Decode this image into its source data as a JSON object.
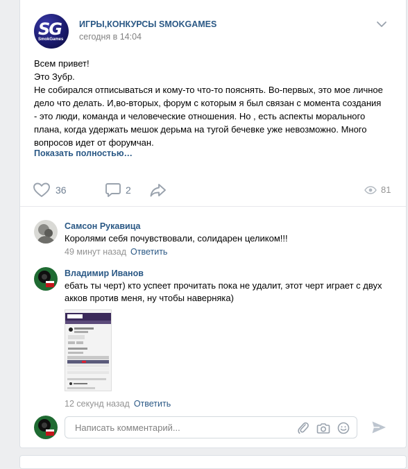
{
  "post": {
    "group_name": "ИГРЫ,КОНКУРСЫ SMOKGAMES",
    "time": "сегодня в 14:04",
    "logo_text": "SG",
    "logo_subtext": "SmokGames",
    "text_lines": [
      "Всем привет!",
      "Это Зубр.",
      "Не собирался отписываться и кому-то что-то пояснять. Во-первых, это мое личное",
      "дело что делать. И,во-вторых, форум с которым я был связан с момента создания",
      "- это люди, команда и человеческие отношения. Но , есть аспекты морального",
      "плана, когда удержать мешок дерьма на тугой бечевке уже невозможно. Много",
      "вопросов идет от форумчан."
    ],
    "show_more": "Показать полностью…",
    "likes": "36",
    "comments": "2",
    "views": "81"
  },
  "comments": [
    {
      "author": "Самсон Рукавица",
      "text": "Королями себя почувствовали, солидарен целиком!!!",
      "time": "49 минут назад",
      "reply": "Ответить"
    },
    {
      "author": "Владимир Иванов",
      "text_lines": [
        "ебать ты черт) кто успеет прочитать пока не удалит, этот черт играет с двух",
        "акков против меня, ну чтобы наверняка)"
      ],
      "time": "12 секунд назад",
      "reply": "Ответить"
    }
  ],
  "comment_input": {
    "placeholder": "Написать комментарий..."
  },
  "colors": {
    "link": "#2a5885",
    "meta": "#939393",
    "icon": "#99a2ad"
  },
  "icons": [
    "chevron-down-icon",
    "heart-icon",
    "comment-icon",
    "share-icon",
    "eye-icon",
    "paperclip-icon",
    "camera-icon",
    "smile-icon",
    "send-icon"
  ]
}
